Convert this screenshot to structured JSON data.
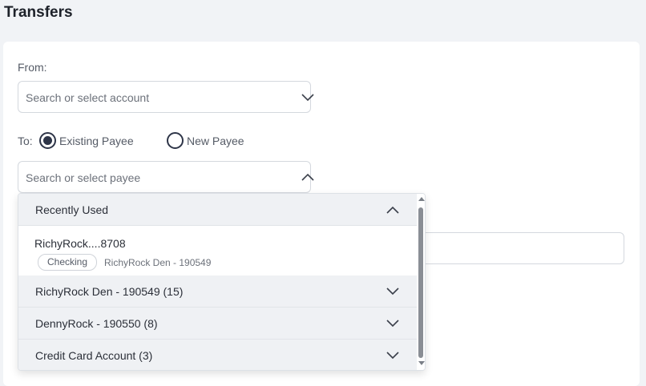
{
  "page": {
    "title": "Transfers"
  },
  "from": {
    "label": "From:",
    "placeholder": "Search or select account"
  },
  "to": {
    "label": "To:",
    "radios": [
      {
        "label": "Existing Payee",
        "checked": true
      },
      {
        "label": "New Payee",
        "checked": false
      }
    ],
    "placeholder": "Search or select payee"
  },
  "dropdown": {
    "groups": [
      {
        "label": "Recently Used",
        "expanded": true
      },
      {
        "label": "RichyRock Den - 190549 (15)",
        "expanded": false
      },
      {
        "label": "DennyRock - 190550 (8)",
        "expanded": false
      },
      {
        "label": "Credit Card Account (3)",
        "expanded": false
      }
    ],
    "recent_item": {
      "account": "RichyRock....8708",
      "type": "Checking",
      "detail": "RichyRock Den - 190549"
    }
  },
  "colors": {
    "accent": "#2e3548",
    "header_bg": "#eff1f4",
    "page_bg": "#f1f3f6"
  },
  "icons": [
    "chevron-down-icon",
    "chevron-up-icon"
  ]
}
